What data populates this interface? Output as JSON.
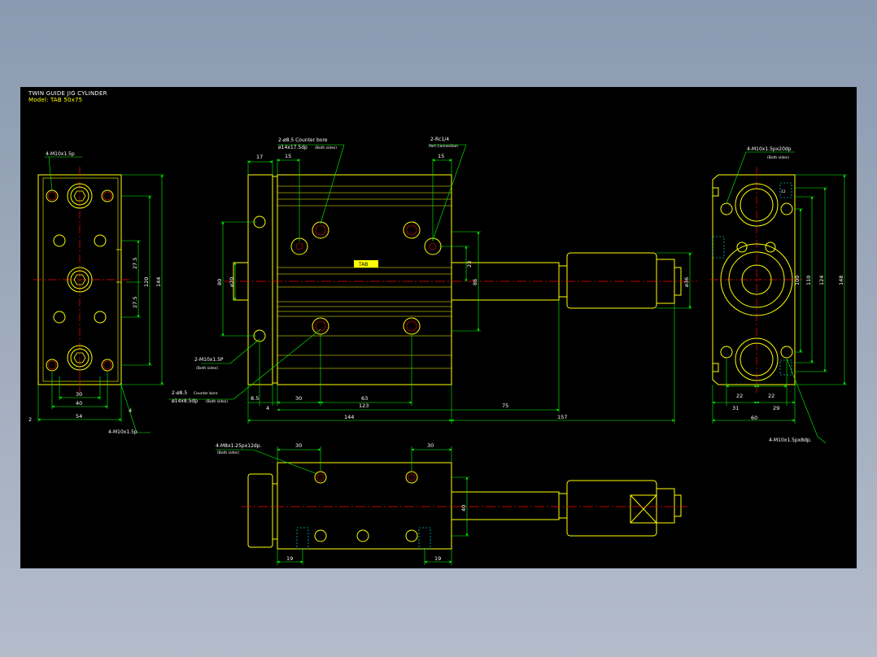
{
  "title": {
    "line1": "TWIN GUIDE JIG CYLINDER",
    "line2": "Model: TAB 50x75"
  },
  "colors": {
    "background": "#000000",
    "outline": "#ffff00",
    "dimension": "#00ff00",
    "centerline": "#ff0000",
    "hidden": "#00ffff",
    "text": "#ffffff"
  },
  "callouts": {
    "left_top": "4-M10x1.5p",
    "left_bottom": "4-M10x1.5p",
    "front_top_bore1": "2-ø8.5 Counter bore",
    "front_top_bore2": "ø14x17.5dp",
    "front_top_both": "(Both sides)",
    "port1": "2-Rc1/4",
    "port2": "Port Connection",
    "front_bottom_m10": "2-M10x1.5P",
    "front_bottom_m10_both": "(Both sides)",
    "front_bottom_bore1": "2-ø8.5",
    "front_bottom_bore1b": "Counter bore",
    "front_bottom_bore2": "ø14x8.5dp",
    "front_bottom_both": "(Both sides)",
    "right_top": "4-M10x1.5px20dp",
    "right_top_both": "(Both sides)",
    "right_bottom": "4-M10x1.5px8dp.",
    "bottom_m8": "4-M8x1.25px12dp.",
    "bottom_m8_both": "(Both sides)"
  },
  "dims": {
    "left": {
      "d30": "30",
      "d40": "40",
      "d54": "54",
      "d2": "2",
      "d4": "4",
      "d27a": "27.5",
      "d27b": "27.5",
      "d120": "120",
      "d144": "144"
    },
    "front": {
      "d17": "17",
      "d15a": "15",
      "d15b": "15",
      "d80": "80",
      "d20": "ø20",
      "d23": "23",
      "d86": "86",
      "d36": "ø36",
      "d8_5": "8.5",
      "d4": "4",
      "d30": "30",
      "d63": "63",
      "d123": "123",
      "d75": "75",
      "d144": "144",
      "d157": "157"
    },
    "right": {
      "d100": "100",
      "d110": "110",
      "d124": "124",
      "d148": "148",
      "d22a": "22",
      "d22b": "22",
      "d31": "31",
      "d29": "29",
      "d60": "60",
      "d12": "12"
    },
    "bottom": {
      "d30a": "30",
      "d30b": "30",
      "d40": "40",
      "d19a": "19",
      "d19b": "19"
    }
  },
  "label_plate": "TAB"
}
